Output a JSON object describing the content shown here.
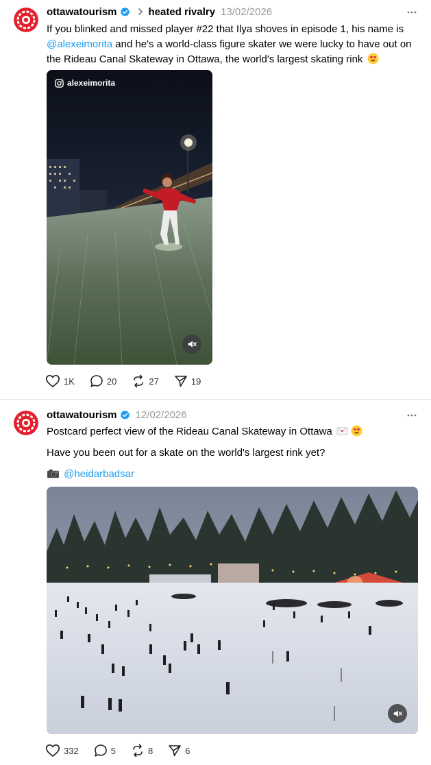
{
  "posts": [
    {
      "username": "ottawatourism",
      "topic": "heated rivalry",
      "date": "13/02/2026",
      "text_a": "If you blinked and missed player #22 that Ilya shoves in episode 1, his name is",
      "mention": "@alexeimorita",
      "text_b": "and he's a world-class figure skater we were lucky to have out on the Rideau Canal Skateway in Ottawa, the world's largest skating rink",
      "media_credit": "alexeimorita",
      "likes": "1K",
      "comments": "20",
      "reposts": "27",
      "shares": "19"
    },
    {
      "username": "ottawatourism",
      "date": "12/02/2026",
      "line1": "Postcard perfect view of the Rideau Canal Skateway in Ottawa",
      "line2": "Have you been out for a skate on the world's largest rink yet?",
      "photo_credit": "@heidarbadsar",
      "likes": "332",
      "comments": "5",
      "reposts": "8",
      "shares": "6"
    }
  ],
  "colors": {
    "brand_red": "#e5202e",
    "verified_blue": "#1d9bf0",
    "mention_blue": "#1d9bf0",
    "date_gray": "#999999"
  },
  "icons": {
    "more": "ellipsis-icon",
    "verified": "verified-badge-icon",
    "chevron": "chevron-right-icon",
    "like": "heart-icon",
    "comment": "comment-bubble-icon",
    "repost": "repost-icon",
    "share": "send-icon",
    "mute": "muted-speaker-icon",
    "instagram": "instagram-icon",
    "camera": "camera-emoji"
  }
}
